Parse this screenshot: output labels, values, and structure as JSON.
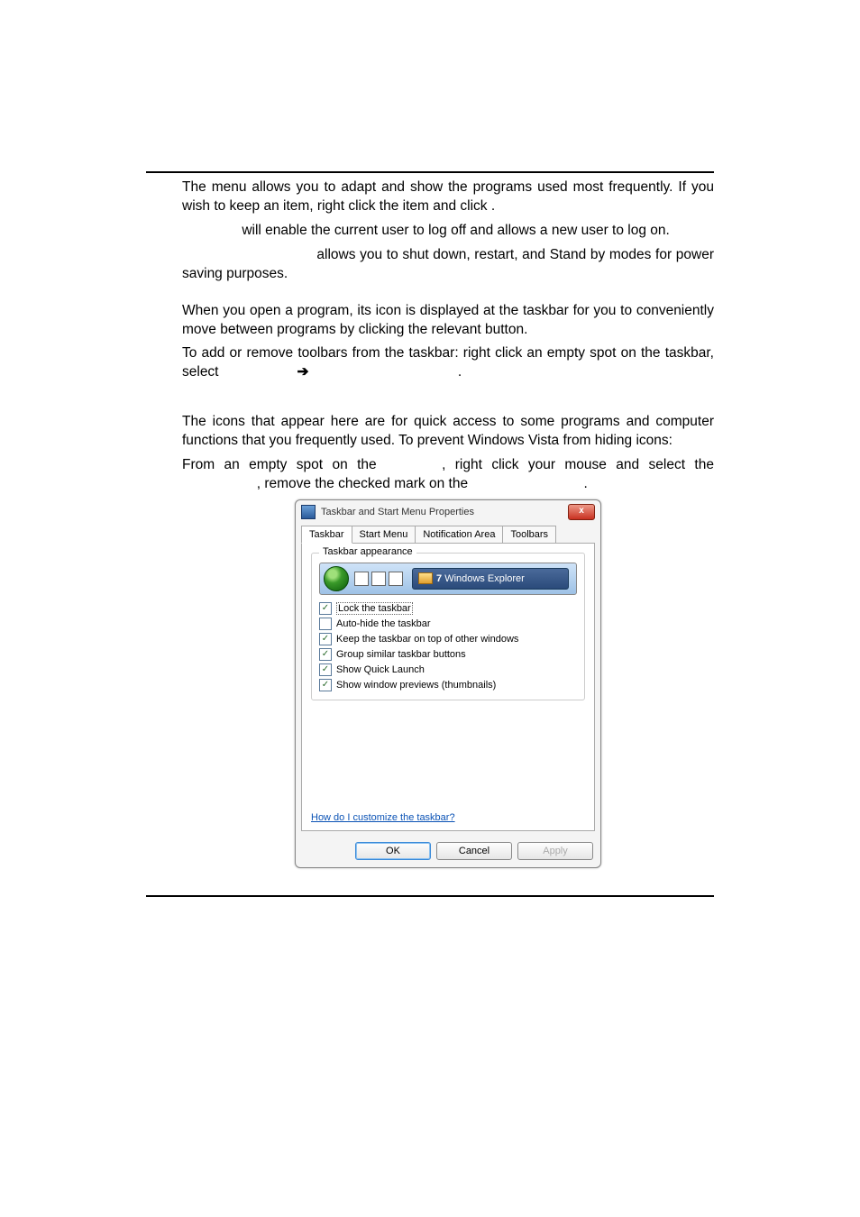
{
  "para1": {
    "a": "The ",
    "b": " menu allows you to adapt and show the programs used most frequently. If you wish to keep an item, right click the item and click ",
    "c": "."
  },
  "para2": " will enable the current user to log off and allows a new user to log on.",
  "para3": " allows you to shut down, restart, and Stand by modes for power saving purposes.",
  "para4": "When you open a program, its icon is displayed at the taskbar for you to conveniently move between programs by clicking the relevant button.",
  "para5": {
    "a": "To add or remove toolbars from the taskbar: right click an empty spot on the taskbar, select ",
    "arrow": "➔",
    "b": " ",
    "c": "."
  },
  "para6": "The icons that appear here are for quick access to some programs and computer functions that you frequently used. To prevent Windows Vista from hiding icons:",
  "para7": {
    "a": "From an empty spot on the ",
    "b": ", right click your mouse and select the ",
    "c": ", remove the checked mark on the ",
    "d": "."
  },
  "dialog": {
    "title": "Taskbar and Start Menu Properties",
    "close": "x",
    "tabs": [
      "Taskbar",
      "Start Menu",
      "Notification Area",
      "Toolbars"
    ],
    "groupLabel": "Taskbar appearance",
    "taskbtn_num": "7",
    "taskbtn_text": "Windows Explorer",
    "checks": [
      {
        "checked": true,
        "label": "Lock the taskbar",
        "dotted": true
      },
      {
        "checked": false,
        "label": "Auto-hide the taskbar"
      },
      {
        "checked": true,
        "label": "Keep the taskbar on top of other windows"
      },
      {
        "checked": true,
        "label": "Group similar taskbar buttons"
      },
      {
        "checked": true,
        "label": "Show Quick Launch"
      },
      {
        "checked": true,
        "label": "Show window previews (thumbnails)"
      }
    ],
    "link": "How do I customize the taskbar?",
    "buttons": {
      "ok": "OK",
      "cancel": "Cancel",
      "apply": "Apply"
    }
  }
}
